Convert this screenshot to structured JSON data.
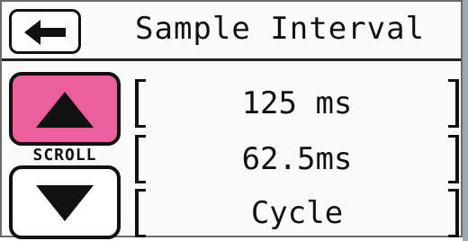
{
  "header": {
    "title": "Sample Interval",
    "back_icon": "left-arrow-icon"
  },
  "scroll": {
    "label": "SCROLL",
    "up_icon": "triangle-up-icon",
    "down_icon": "triangle-down-icon",
    "up_color": "#e9609d"
  },
  "list": {
    "items": [
      {
        "label": "125 ms"
      },
      {
        "label": "62.5ms"
      },
      {
        "label": "Cycle"
      }
    ]
  }
}
